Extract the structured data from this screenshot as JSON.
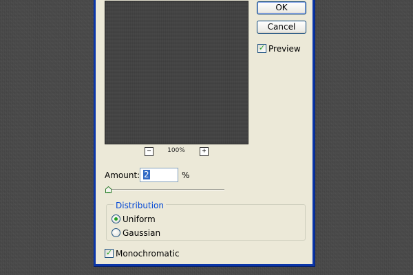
{
  "buttons": {
    "ok_label": "OK",
    "cancel_label": "Cancel"
  },
  "preview": {
    "label": "Preview",
    "checked": true,
    "zoom_out_symbol": "−",
    "zoom_in_symbol": "+",
    "zoom_level": "100%"
  },
  "amount": {
    "label": "Amount:",
    "value": "2",
    "unit": "%",
    "slider_fraction": 0.02
  },
  "distribution": {
    "title": "Distribution",
    "options": [
      {
        "label": "Uniform",
        "selected": true
      },
      {
        "label": "Gaussian",
        "selected": false
      }
    ]
  },
  "monochromatic": {
    "label": "Monochromatic",
    "checked": true
  },
  "colors": {
    "title_bar_blue": "#0b36a8",
    "dialog_face": "#ece9d8",
    "group_title_blue": "#0046d5",
    "check_green": "#21a121",
    "selection_blue": "#316ac5"
  },
  "icons": {
    "check": "check-icon",
    "radio_dot": "radio-dot-icon",
    "slider_thumb": "slider-thumb-icon",
    "zoom_out": "zoom-out-icon",
    "zoom_in": "zoom-in-icon"
  }
}
